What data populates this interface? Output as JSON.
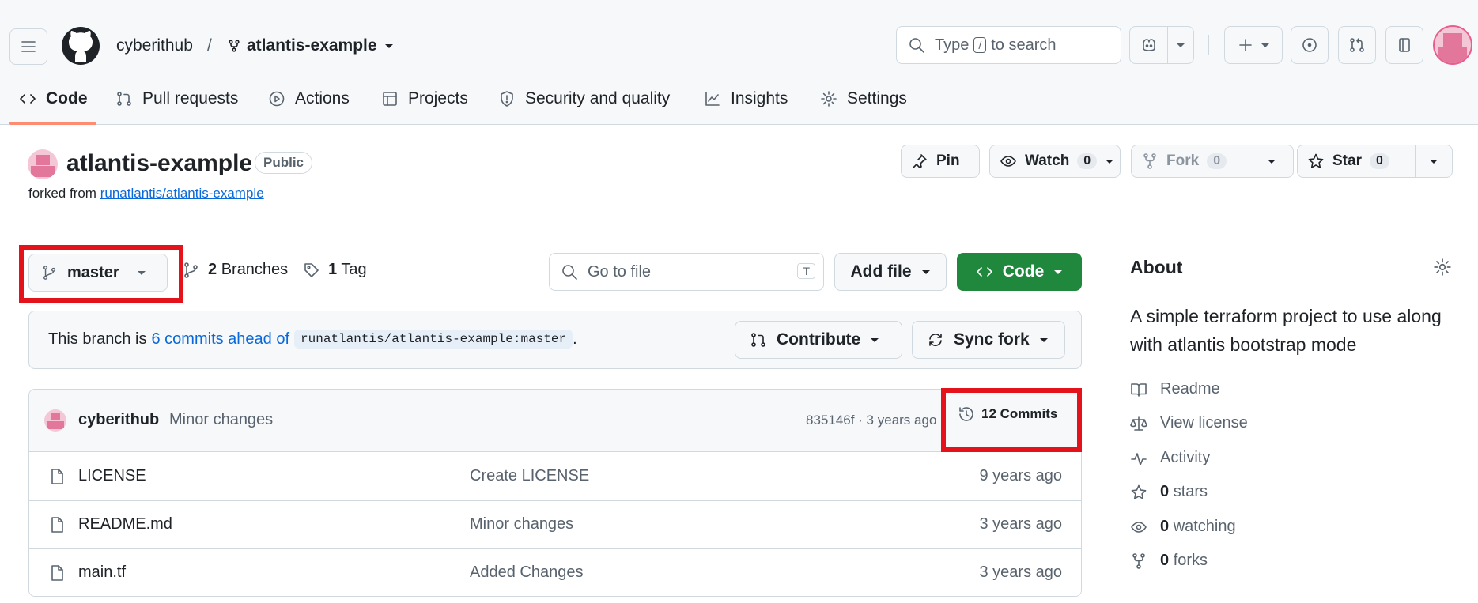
{
  "header": {
    "owner": "cyberithub",
    "separator": "/",
    "repo": "atlantis-example",
    "search": {
      "prefix": "Type",
      "key": "/",
      "suffix": "to search"
    }
  },
  "tabs": [
    {
      "label": "Code"
    },
    {
      "label": "Pull requests"
    },
    {
      "label": "Actions"
    },
    {
      "label": "Projects"
    },
    {
      "label": "Security and quality"
    },
    {
      "label": "Insights"
    },
    {
      "label": "Settings"
    }
  ],
  "repo": {
    "name": "atlantis-example",
    "visibility": "Public",
    "forked_prefix": "forked from",
    "forked_from": "runatlantis/atlantis-example",
    "pin_label": "Pin",
    "watch_label": "Watch",
    "watch_count": "0",
    "fork_label": "Fork",
    "fork_count": "0",
    "star_label": "Star",
    "star_count": "0"
  },
  "filenav": {
    "branch": "master",
    "branches_count": "2",
    "branches_label": "Branches",
    "tags_count": "1",
    "tags_label": "Tag",
    "goto_placeholder": "Go to file",
    "goto_key": "T",
    "add_file": "Add file",
    "code": "Code"
  },
  "ahead": {
    "prefix": "This branch is",
    "link": "6 commits ahead of",
    "ref": "runatlantis/atlantis-example:master",
    "suffix": ".",
    "contribute": "Contribute",
    "sync": "Sync fork"
  },
  "commit": {
    "author": "cyberithub",
    "message": "Minor changes",
    "meta": "835146f · 3 years ago",
    "commits_label": "12 Commits"
  },
  "files": [
    {
      "name": "LICENSE",
      "message": "Create LICENSE",
      "date": "9 years ago"
    },
    {
      "name": "README.md",
      "message": "Minor changes",
      "date": "3 years ago"
    },
    {
      "name": "main.tf",
      "message": "Added Changes",
      "date": "3 years ago"
    }
  ],
  "about": {
    "title": "About",
    "description": "A simple terraform project to use along with atlantis bootstrap mode",
    "readme": "Readme",
    "license": "View license",
    "activity": "Activity",
    "stars_count": "0",
    "stars_label": "stars",
    "watching_count": "0",
    "watching_label": "watching",
    "forks_count": "0",
    "forks_label": "forks"
  },
  "colors": {
    "primary_green": "#1f883d",
    "link_blue": "#0969da",
    "highlight_red": "#e3121b",
    "tab_underline": "#fd8c73"
  }
}
